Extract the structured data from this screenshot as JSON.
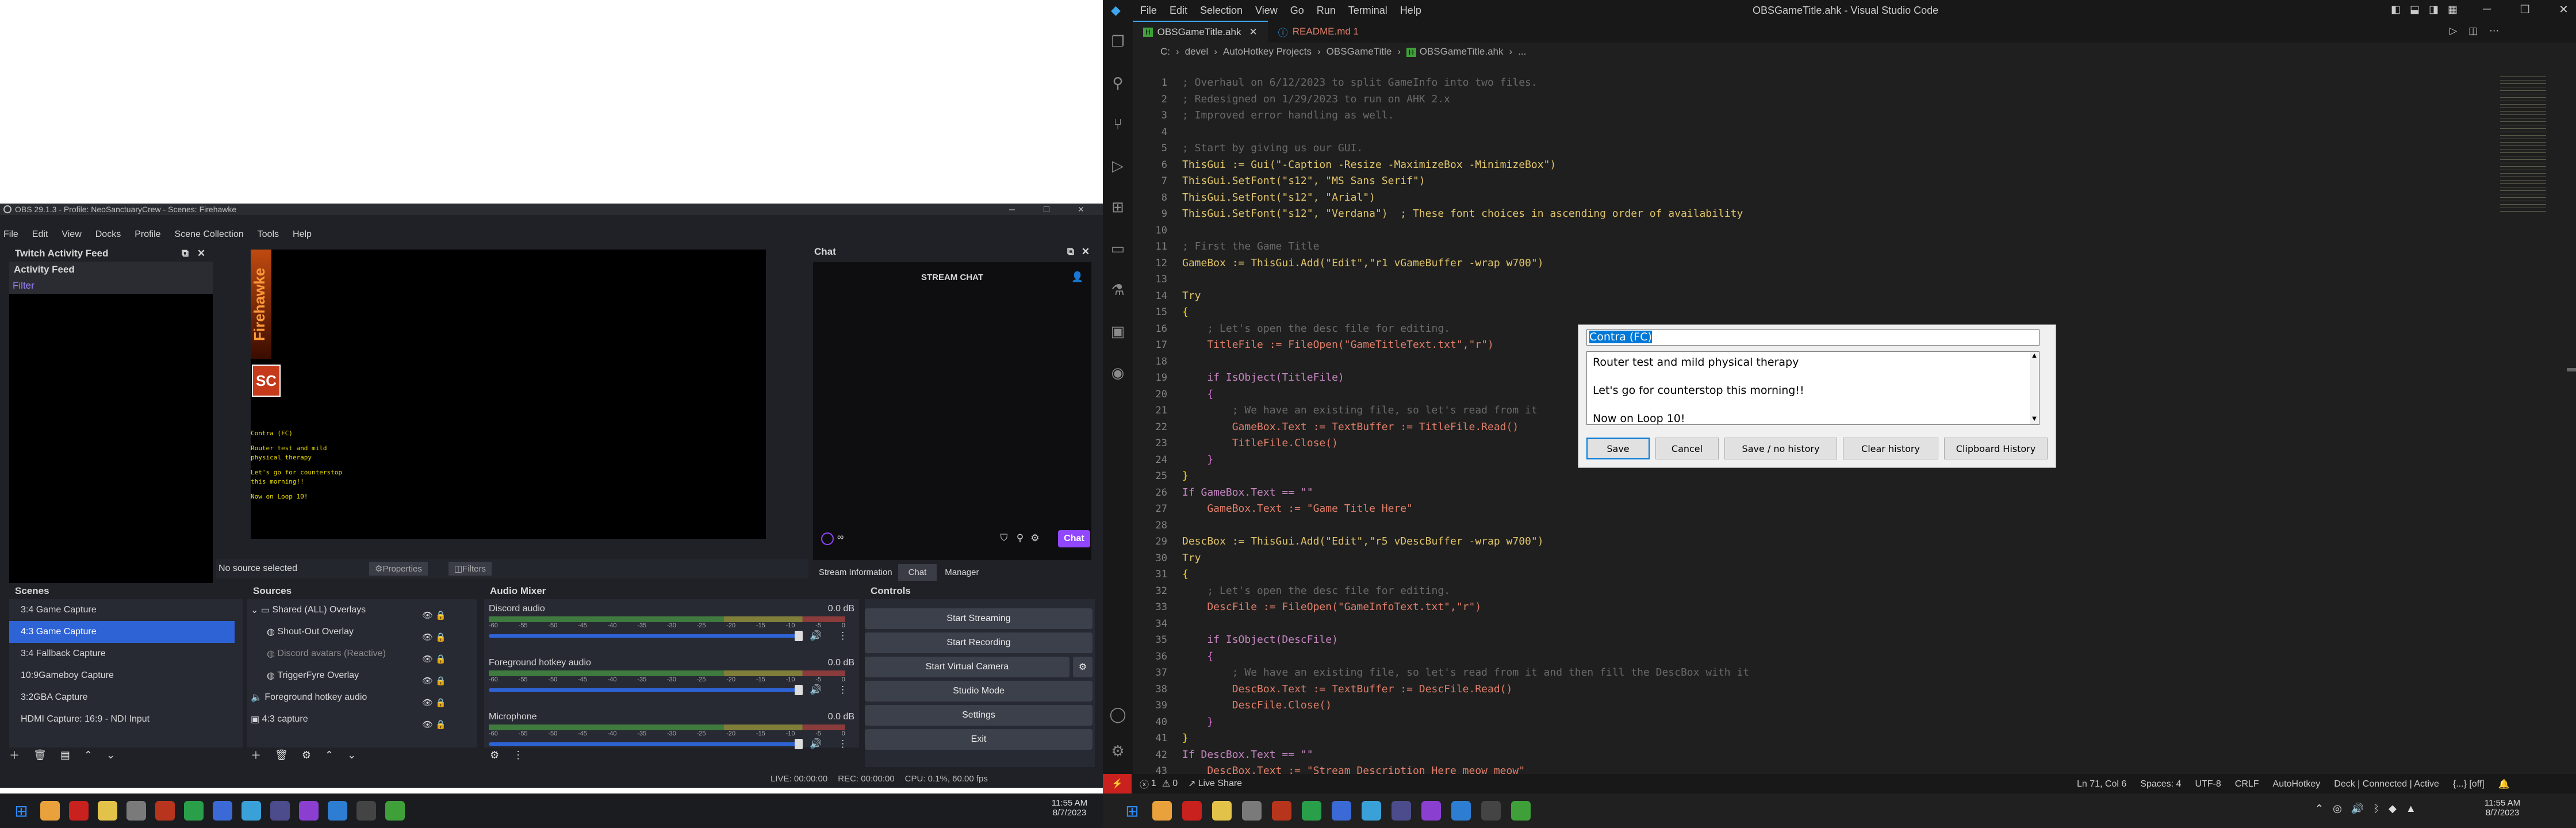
{
  "obs": {
    "title": "OBS 29.1.3 - Profile: NeoSanctuaryCrew - Scenes: Firehawke",
    "menu": [
      "File",
      "Edit",
      "View",
      "Docks",
      "Profile",
      "Scene Collection",
      "Tools",
      "Help"
    ],
    "activity": {
      "header": "Twitch Activity Feed",
      "title": "Activity Feed",
      "filter": "Filter"
    },
    "preview": {
      "logo": "Firehawke",
      "badge": "SC",
      "lines": [
        "Contra (FC)",
        "Router test and mild",
        "physical therapy",
        "Let's go for counterstop",
        "this morning!!",
        "Now on Loop 10!"
      ]
    },
    "chat": {
      "header": "Chat",
      "title": "STREAM CHAT",
      "button": "Chat",
      "infinity": "∞",
      "tabs": [
        "Stream Information",
        "Chat",
        "Manager"
      ]
    },
    "source_bar": {
      "status": "No source selected",
      "properties": "Properties",
      "filters": "Filters"
    },
    "scenes": {
      "header": "Scenes",
      "items": [
        "3:4 Game Capture",
        "4:3 Game Capture",
        "3:4 Fallback Capture",
        "10:9Gameboy Capture",
        "3:2GBA Capture",
        "HDMI Capture: 16:9 - NDI Input"
      ],
      "selected": 1
    },
    "sources": {
      "header": "Sources",
      "items": [
        "Shared (ALL) Overlays",
        "Shout-Out Overlay",
        "Discord avatars (Reactive)",
        "TriggerFyre Overlay",
        "Foreground hotkey audio",
        "4:3 capture"
      ]
    },
    "mixer": {
      "header": "Audio Mixer",
      "channels": [
        {
          "name": "Discord audio",
          "db": "0.0 dB"
        },
        {
          "name": "Foreground hotkey audio",
          "db": "0.0 dB"
        },
        {
          "name": "Microphone",
          "db": "0.0 dB"
        }
      ],
      "ticks": [
        "-60",
        "-55",
        "-50",
        "-45",
        "-40",
        "-35",
        "-30",
        "-25",
        "-20",
        "-15",
        "-10",
        "-5",
        "0"
      ]
    },
    "controls": {
      "header": "Controls",
      "buttons": [
        "Start Streaming",
        "Start Recording",
        "Start Virtual Camera",
        "Studio Mode",
        "Settings",
        "Exit"
      ]
    },
    "status": {
      "live": "LIVE: 00:00:00",
      "rec": "REC: 00:00:00",
      "cpu": "CPU: 0.1%, 60.00 fps"
    }
  },
  "vscode": {
    "menu": [
      "File",
      "Edit",
      "Selection",
      "View",
      "Go",
      "Run",
      "Terminal",
      "Help"
    ],
    "window_title": "OBSGameTitle.ahk - Visual Studio Code",
    "tabs": [
      {
        "label": "OBSGameTitle.ahk",
        "active": true
      },
      {
        "label": "README.md 1",
        "active": false
      }
    ],
    "breadcrumb": [
      "C:",
      "devel",
      "AutoHotkey Projects",
      "OBSGameTitle",
      "OBSGameTitle.ahk",
      "..."
    ],
    "lines": [
      {
        "n": "1",
        "t": "; Overhaul on 6/12/2023 to split GameInfo into two files.",
        "c": "#6a6a6a"
      },
      {
        "n": "2",
        "t": "; Redesigned on 1/29/2023 to run on AHK 2.x",
        "c": "#6a6a6a"
      },
      {
        "n": "3",
        "t": "; Improved error handling as well.",
        "c": "#6a6a6a"
      },
      {
        "n": "4",
        "t": "",
        "c": "#ccc"
      },
      {
        "n": "5",
        "t": "; Start by giving us our GUI.",
        "c": "#6a6a6a"
      },
      {
        "n": "6",
        "t": "ThisGui := Gui(\"-Caption -Resize -MaximizeBox -MinimizeBox\")",
        "c": "#e0c46a"
      },
      {
        "n": "7",
        "t": "ThisGui.SetFont(\"s12\", \"MS Sans Serif\")",
        "c": "#e0c46a"
      },
      {
        "n": "8",
        "t": "ThisGui.SetFont(\"s12\", \"Arial\")",
        "c": "#e0c46a"
      },
      {
        "n": "9",
        "t": "ThisGui.SetFont(\"s12\", \"Verdana\")  ; These font choices in ascending order of availability",
        "c": "#e0c46a"
      },
      {
        "n": "10",
        "t": "",
        "c": "#ccc"
      },
      {
        "n": "11",
        "t": "; First the Game Title",
        "c": "#6a6a6a"
      },
      {
        "n": "12",
        "t": "GameBox := ThisGui.Add(\"Edit\",\"r1 vGameBuffer -wrap w700\")",
        "c": "#e0c46a"
      },
      {
        "n": "13",
        "t": "",
        "c": "#ccc"
      },
      {
        "n": "14",
        "t": "Try",
        "c": "#e0c46a"
      },
      {
        "n": "15",
        "t": "{",
        "c": "#ffd700"
      },
      {
        "n": "16",
        "t": "    ; Let's open the desc file for editing.",
        "c": "#6a6a6a"
      },
      {
        "n": "17",
        "t": "    TitleFile := FileOpen(\"GameTitleText.txt\",\"r\")",
        "c": "#e07f6a"
      },
      {
        "n": "18",
        "t": "",
        "c": "#ccc"
      },
      {
        "n": "19",
        "t": "    if IsObject(TitleFile)",
        "c": "#c586c0"
      },
      {
        "n": "20",
        "t": "    {",
        "c": "#da70d6"
      },
      {
        "n": "21",
        "t": "        ; We have an existing file, so let's read from it",
        "c": "#6a6a6a"
      },
      {
        "n": "22",
        "t": "        GameBox.Text := TextBuffer := TitleFile.Read()",
        "c": "#e07f6a"
      },
      {
        "n": "23",
        "t": "        TitleFile.Close()",
        "c": "#e07f6a"
      },
      {
        "n": "24",
        "t": "    }",
        "c": "#da70d6"
      },
      {
        "n": "25",
        "t": "}",
        "c": "#ffd700"
      },
      {
        "n": "26",
        "t": "If GameBox.Text == \"\"",
        "c": "#c586c0"
      },
      {
        "n": "27",
        "t": "    GameBox.Text := \"Game Title Here\"",
        "c": "#e07f6a"
      },
      {
        "n": "28",
        "t": "",
        "c": "#ccc"
      },
      {
        "n": "29",
        "t": "DescBox := ThisGui.Add(\"Edit\",\"r5 vDescBuffer -wrap w700\")",
        "c": "#e0c46a"
      },
      {
        "n": "30",
        "t": "Try",
        "c": "#e0c46a"
      },
      {
        "n": "31",
        "t": "{",
        "c": "#ffd700"
      },
      {
        "n": "32",
        "t": "    ; Let's open the desc file for editing.",
        "c": "#6a6a6a"
      },
      {
        "n": "33",
        "t": "    DescFile := FileOpen(\"GameInfoText.txt\",\"r\")",
        "c": "#e07f6a"
      },
      {
        "n": "34",
        "t": "",
        "c": "#ccc"
      },
      {
        "n": "35",
        "t": "    if IsObject(DescFile)",
        "c": "#c586c0"
      },
      {
        "n": "36",
        "t": "    {",
        "c": "#da70d6"
      },
      {
        "n": "37",
        "t": "        ; We have an existing file, so let's read from it and then fill the DescBox with it",
        "c": "#6a6a6a"
      },
      {
        "n": "38",
        "t": "        DescBox.Text := TextBuffer := DescFile.Read()",
        "c": "#e07f6a"
      },
      {
        "n": "39",
        "t": "        DescFile.Close()",
        "c": "#e07f6a"
      },
      {
        "n": "40",
        "t": "    }",
        "c": "#da70d6"
      },
      {
        "n": "41",
        "t": "}",
        "c": "#ffd700"
      },
      {
        "n": "42",
        "t": "If DescBox.Text == \"\"",
        "c": "#c586c0"
      },
      {
        "n": "43",
        "t": "    DescBox.Text := \"Stream Description Here meow meow\"",
        "c": "#e07f6a"
      }
    ],
    "dialog": {
      "title_value": "Contra (FC)",
      "desc_lines": [
        "Router test and mild physical therapy",
        "",
        "Let's go for counterstop this morning!!",
        "",
        "Now on Loop 10!"
      ],
      "buttons": [
        "Save",
        "Cancel",
        "Save / no history",
        "Clear history",
        "Clipboard History"
      ]
    },
    "statusbar": {
      "errors": "1",
      "warnings": "0",
      "live_share": "Live Share",
      "position": "Ln 71, Col 6",
      "spaces": "Spaces: 4",
      "encoding": "UTF-8",
      "eol": "CRLF",
      "language": "AutoHotkey",
      "deck": "Deck | Connected | Active",
      "off": "{...} [off]"
    }
  },
  "taskbar_left": {
    "time": "11:55 AM",
    "date": "8/7/2023"
  },
  "taskbar_right": {
    "time": "11:55 AM",
    "date": "8/7/2023"
  },
  "colors": {
    "obs_accent": "#2e63d6",
    "vscode_accent_red": "#c9211e",
    "twitch_purple": "#9146ff"
  }
}
